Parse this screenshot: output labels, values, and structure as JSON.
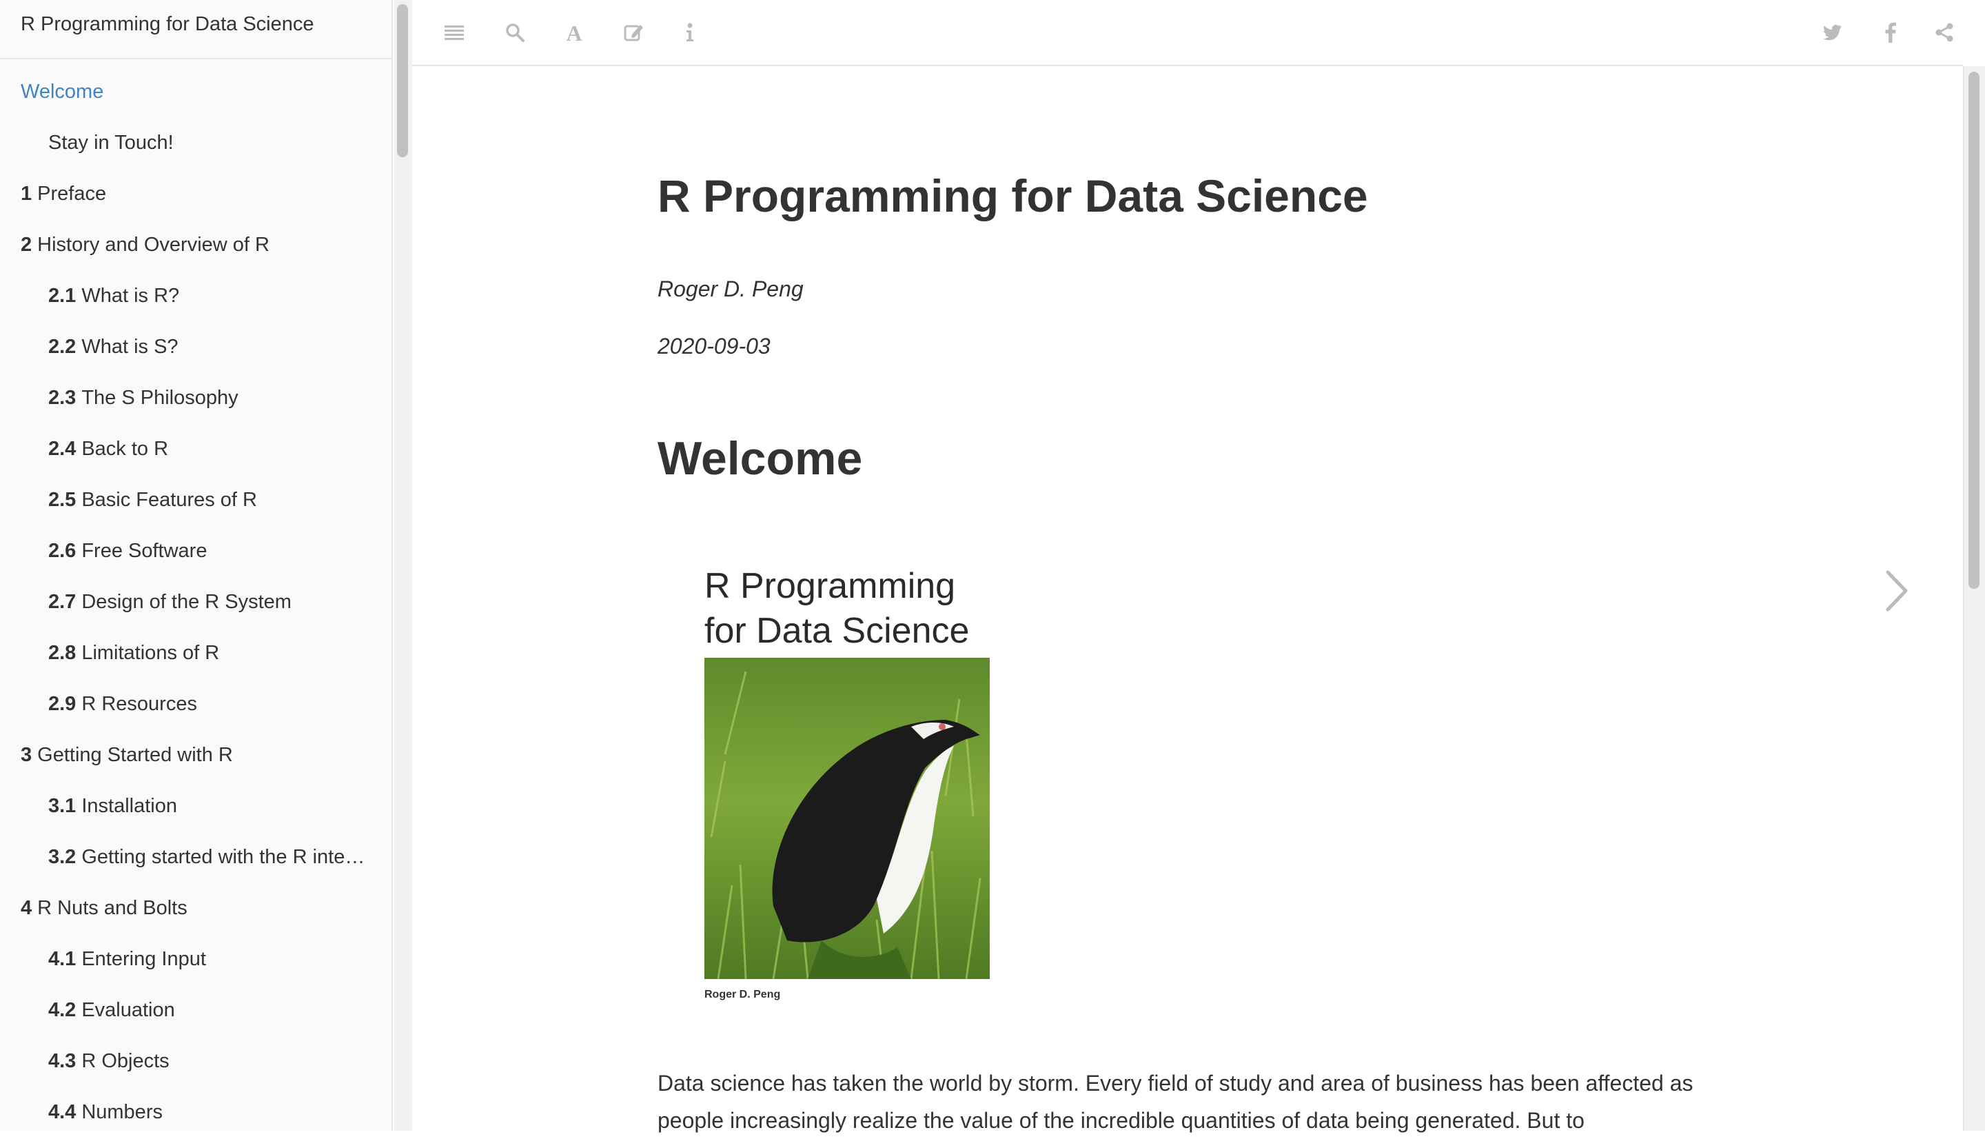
{
  "sidebar": {
    "title": "R Programming for Data Science",
    "items": [
      {
        "num": "",
        "label": "Welcome",
        "level": 1,
        "active": true
      },
      {
        "num": "",
        "label": "Stay in Touch!",
        "level": 2
      },
      {
        "num": "1",
        "label": "Preface",
        "level": 1
      },
      {
        "num": "2",
        "label": "History and Overview of R",
        "level": 1
      },
      {
        "num": "2.1",
        "label": "What is R?",
        "level": 2
      },
      {
        "num": "2.2",
        "label": "What is S?",
        "level": 2
      },
      {
        "num": "2.3",
        "label": "The S Philosophy",
        "level": 2
      },
      {
        "num": "2.4",
        "label": "Back to R",
        "level": 2
      },
      {
        "num": "2.5",
        "label": "Basic Features of R",
        "level": 2
      },
      {
        "num": "2.6",
        "label": "Free Software",
        "level": 2
      },
      {
        "num": "2.7",
        "label": "Design of the R System",
        "level": 2
      },
      {
        "num": "2.8",
        "label": "Limitations of R",
        "level": 2
      },
      {
        "num": "2.9",
        "label": "R Resources",
        "level": 2
      },
      {
        "num": "3",
        "label": "Getting Started with R",
        "level": 1
      },
      {
        "num": "3.1",
        "label": "Installation",
        "level": 2
      },
      {
        "num": "3.2",
        "label": "Getting started with the R inte…",
        "level": 2
      },
      {
        "num": "4",
        "label": "R Nuts and Bolts",
        "level": 1
      },
      {
        "num": "4.1",
        "label": "Entering Input",
        "level": 2
      },
      {
        "num": "4.2",
        "label": "Evaluation",
        "level": 2
      },
      {
        "num": "4.3",
        "label": "R Objects",
        "level": 2
      },
      {
        "num": "4.4",
        "label": "Numbers",
        "level": 2
      }
    ]
  },
  "toolbar": {
    "left_icons": [
      "menu-icon",
      "search-icon",
      "font-icon",
      "edit-icon",
      "info-icon"
    ],
    "right_icons": [
      "twitter-icon",
      "facebook-icon",
      "share-icon"
    ],
    "icon_color": "#bbbbbb"
  },
  "content": {
    "title": "R Programming for Data Science",
    "author": "Roger D. Peng",
    "date": "2020-09-03",
    "section_heading": "Welcome",
    "cover": {
      "title_line1": "R Programming",
      "title_line2": "for Data Science",
      "author": "Roger D. Peng"
    },
    "intro": "Data science has taken the world by storm. Every field of study and area of business has been affected as people increasingly realize the value of the incredible quantities of data being generated. But to"
  },
  "colors": {
    "accent": "#4183c4",
    "text": "#333333",
    "sidebar_bg": "#fafafa"
  }
}
